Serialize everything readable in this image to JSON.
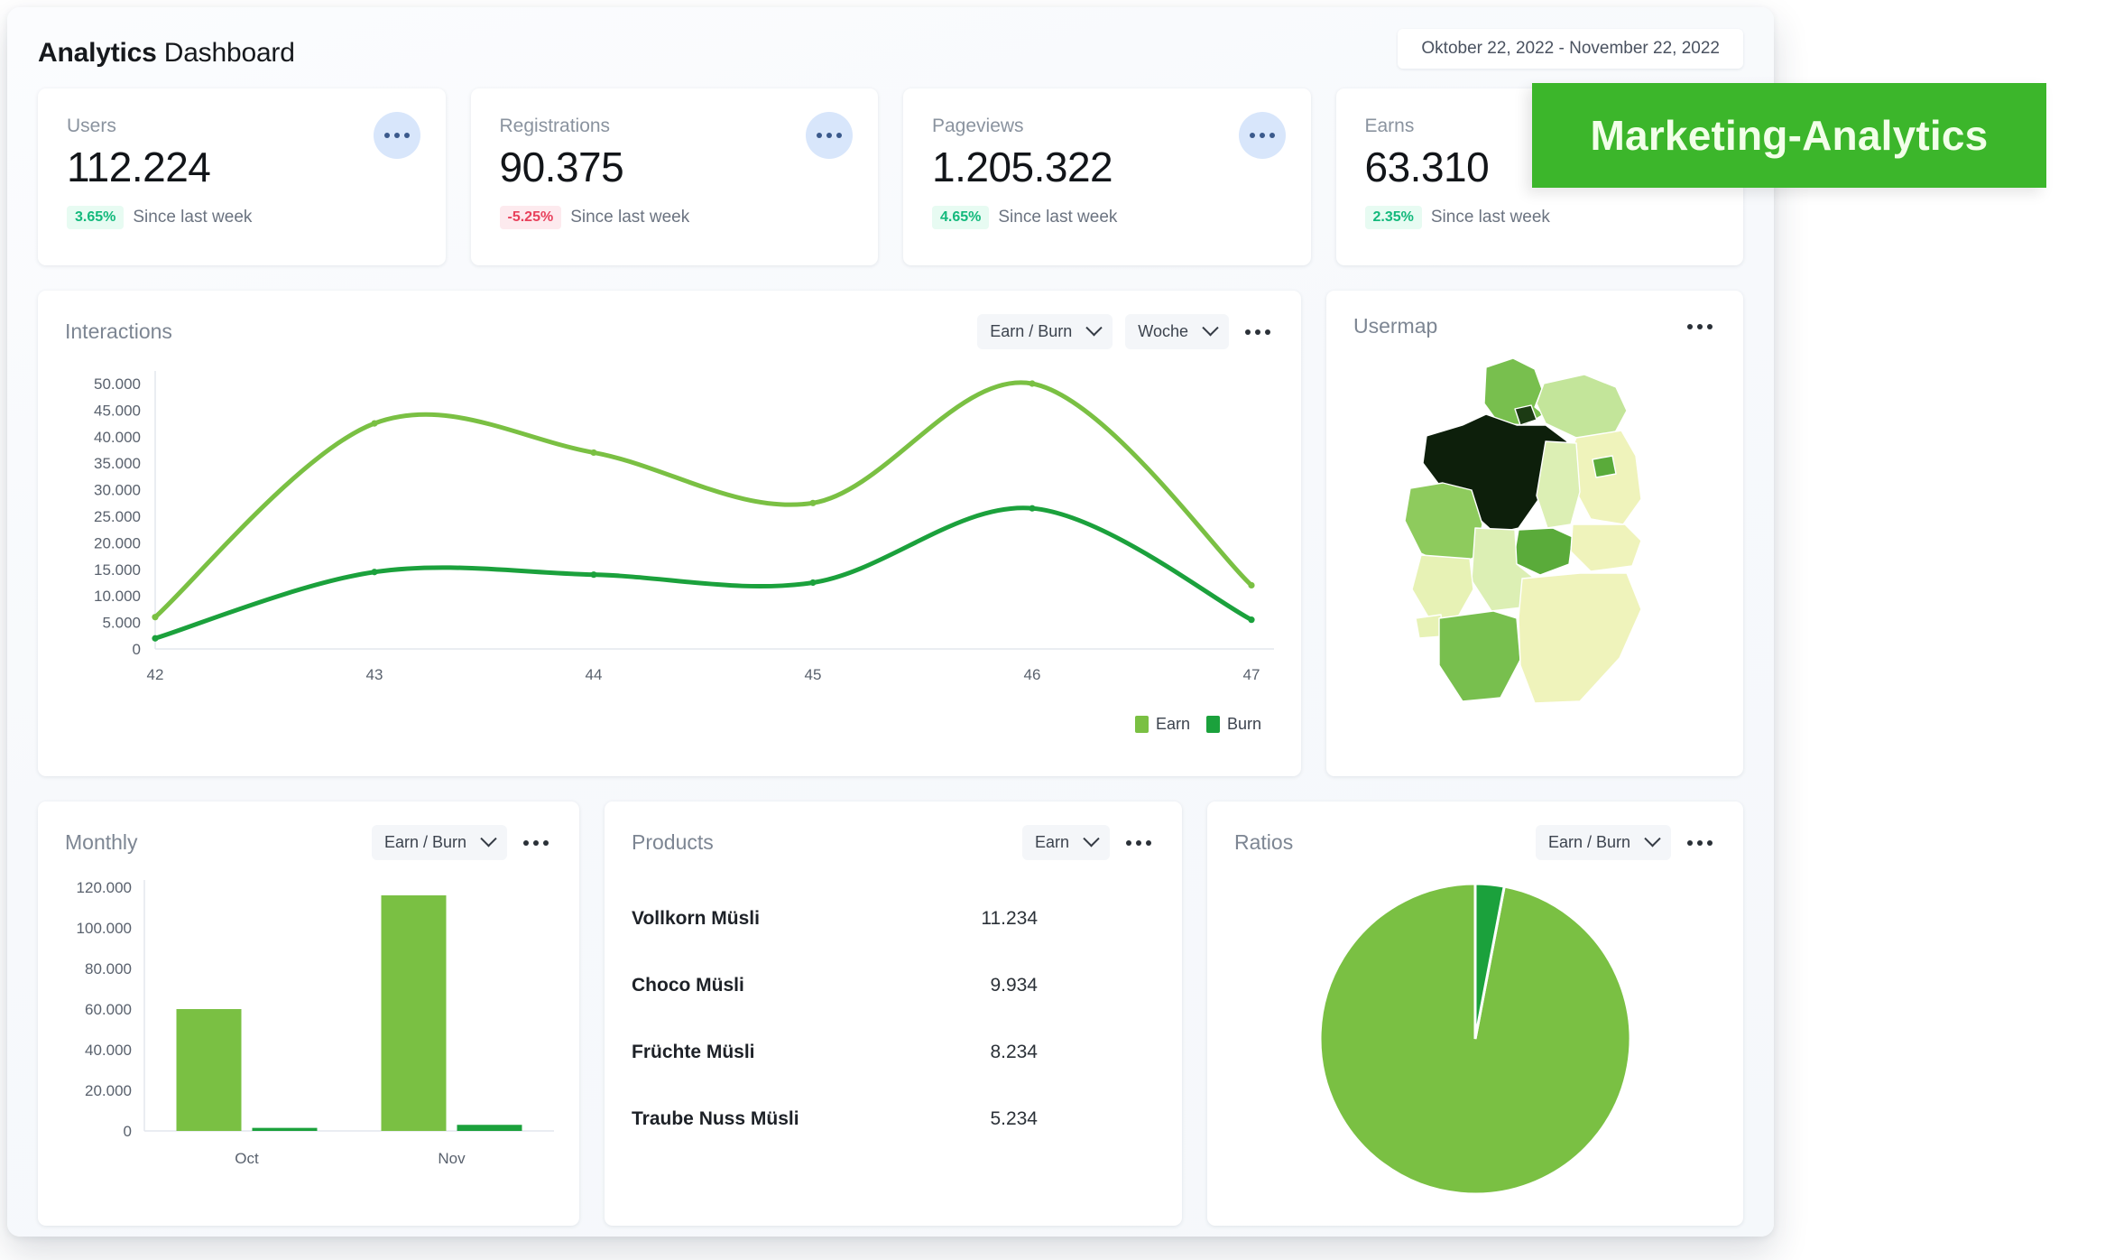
{
  "header": {
    "title_strong": "Analytics",
    "title_light": "Dashboard",
    "date_range": "Oktober 22, 2022 - November 22, 2022"
  },
  "banner": {
    "label": "Marketing-Analytics",
    "color": "#3cb62b"
  },
  "kpis": [
    {
      "label": "Users",
      "value": "112.224",
      "delta": "3.65%",
      "direction": "up",
      "since": "Since last week"
    },
    {
      "label": "Registrations",
      "value": "90.375",
      "delta": "-5.25%",
      "direction": "down",
      "since": "Since last week"
    },
    {
      "label": "Pageviews",
      "value": "1.205.322",
      "delta": "4.65%",
      "direction": "up",
      "since": "Since last week"
    },
    {
      "label": "Earns",
      "value": "63.310",
      "delta": "2.35%",
      "direction": "up",
      "since": "Since last week"
    }
  ],
  "interactions": {
    "title": "Interactions",
    "select_metric": "Earn / Burn",
    "select_period": "Woche"
  },
  "usermap": {
    "title": "Usermap"
  },
  "monthly": {
    "title": "Monthly",
    "select_metric": "Earn / Burn"
  },
  "products": {
    "title": "Products",
    "select_metric": "Earn",
    "items": [
      {
        "name": "Vollkorn Müsli",
        "value": "11.234"
      },
      {
        "name": "Choco Müsli",
        "value": "9.934"
      },
      {
        "name": "Früchte Müsli",
        "value": "8.234"
      },
      {
        "name": "Traube Nuss Müsli",
        "value": "5.234"
      }
    ]
  },
  "ratios": {
    "title": "Ratios",
    "select_metric": "Earn / Burn"
  },
  "colors": {
    "earn": "#7ac043",
    "burn": "#1ba13c",
    "positive": "#13b97c",
    "negative": "#e8415c",
    "map_darkest": "#0d1f0b"
  },
  "chart_data": [
    {
      "type": "line",
      "title": "Interactions",
      "x": [
        42,
        43,
        44,
        45,
        46,
        47
      ],
      "xlabel": "",
      "ylabel": "",
      "ylim": [
        0,
        50000
      ],
      "yticks": [
        "0",
        "5.000",
        "10.000",
        "15.000",
        "20.000",
        "25.000",
        "30.000",
        "35.000",
        "40.000",
        "45.000",
        "50.000"
      ],
      "grid": false,
      "legend": "bottom-right",
      "series": [
        {
          "name": "Earn",
          "color": "#7ac043",
          "values": [
            6000,
            42500,
            37000,
            27500,
            50000,
            12000
          ]
        },
        {
          "name": "Burn",
          "color": "#1ba13c",
          "values": [
            2000,
            14500,
            14000,
            12500,
            26500,
            5500
          ]
        }
      ]
    },
    {
      "type": "bar",
      "title": "Monthly",
      "categories": [
        "Oct",
        "Nov"
      ],
      "ylim": [
        0,
        120000
      ],
      "yticks": [
        "0",
        "20.000",
        "40.000",
        "60.000",
        "80.000",
        "100.000",
        "120.000"
      ],
      "series": [
        {
          "name": "Earn",
          "color": "#7ac043",
          "values": [
            60000,
            116000
          ]
        },
        {
          "name": "Burn",
          "color": "#1ba13c",
          "values": [
            1500,
            3000
          ]
        }
      ]
    },
    {
      "type": "pie",
      "title": "Ratios",
      "labels": [
        "Earn",
        "Burn"
      ],
      "values": [
        97,
        3
      ],
      "colors": [
        "#7ac043",
        "#1ba13c"
      ]
    },
    {
      "type": "heatmap",
      "title": "Usermap",
      "region": "Germany",
      "states": [
        {
          "name": "Schleswig-Holstein",
          "color": "#78bf4e"
        },
        {
          "name": "Mecklenburg-Vorpommern",
          "color": "#c3e59a"
        },
        {
          "name": "Hamburg",
          "color": "#1c3b14"
        },
        {
          "name": "Bremen",
          "color": "#0d1f0b"
        },
        {
          "name": "Niedersachsen",
          "color": "#0d1f0b"
        },
        {
          "name": "Brandenburg",
          "color": "#eff3bb"
        },
        {
          "name": "Berlin",
          "color": "#5aab3a"
        },
        {
          "name": "Sachsen-Anhalt",
          "color": "#dcefb4"
        },
        {
          "name": "Nordrhein-Westfalen",
          "color": "#8ecb5d"
        },
        {
          "name": "Thüringen",
          "color": "#5aab3a"
        },
        {
          "name": "Sachsen",
          "color": "#eff3bb"
        },
        {
          "name": "Hessen",
          "color": "#dcefb4"
        },
        {
          "name": "Rheinland-Pfalz",
          "color": "#e7f2b5"
        },
        {
          "name": "Saarland",
          "color": "#e7f2b5"
        },
        {
          "name": "Baden-Württemberg",
          "color": "#78bf4e"
        },
        {
          "name": "Bayern",
          "color": "#eff3bb"
        }
      ]
    }
  ]
}
